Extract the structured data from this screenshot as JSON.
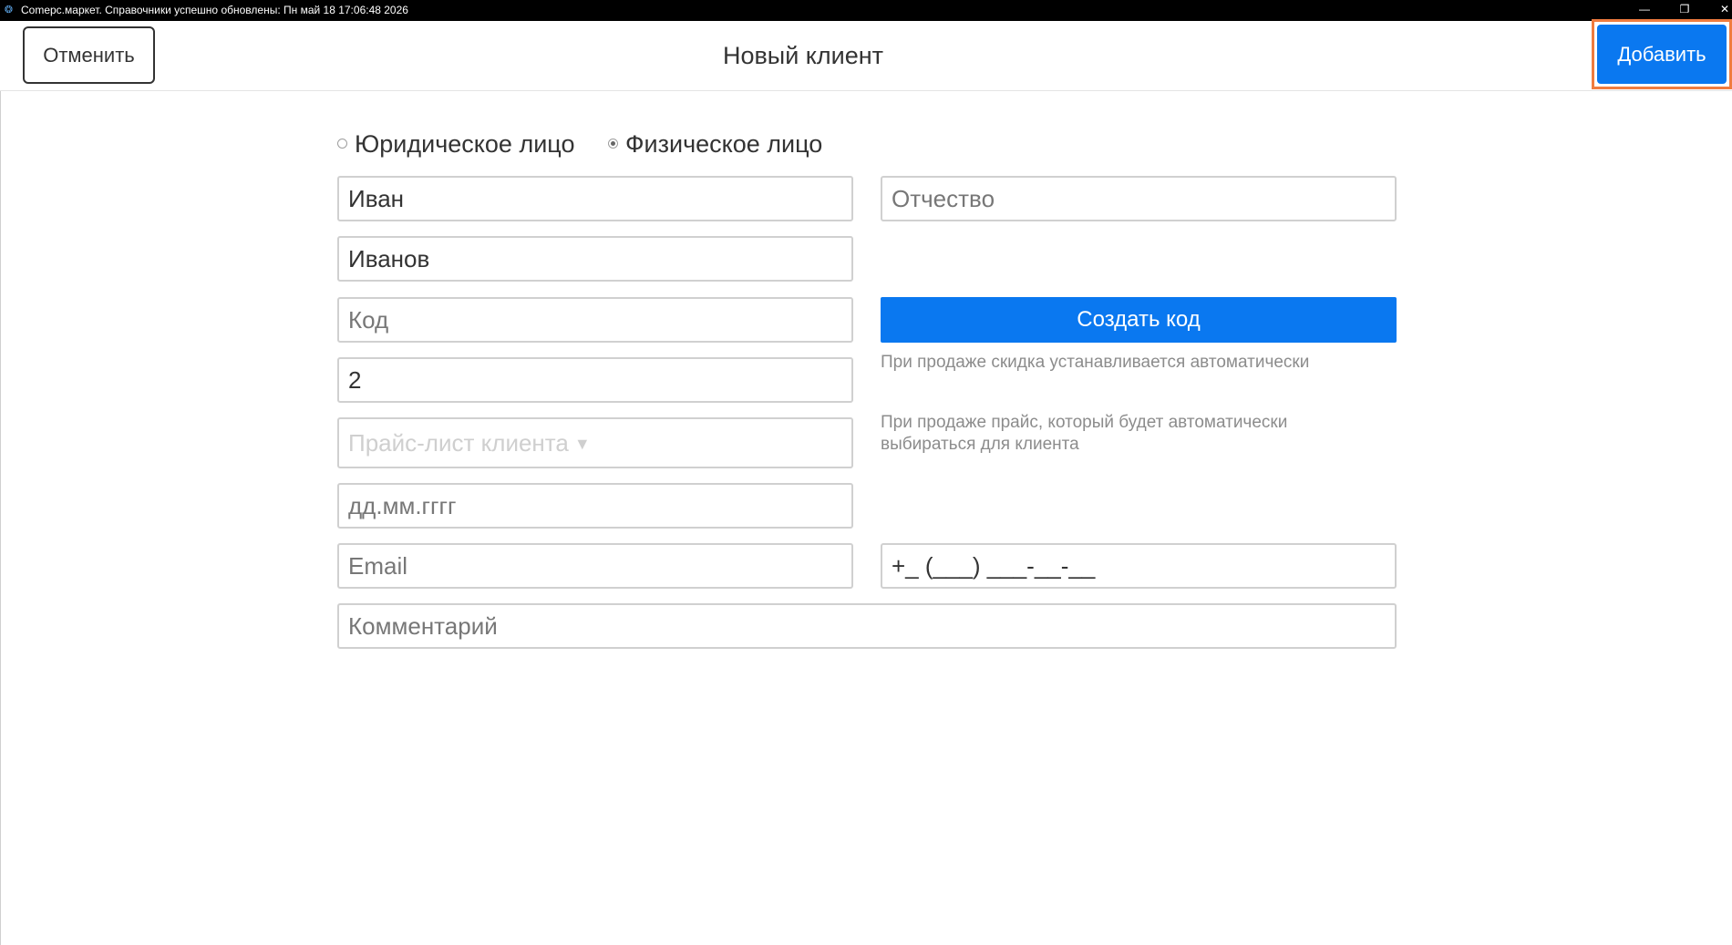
{
  "window": {
    "title": "Comepc.маркет. Справочники успешно обновлены: Пн май 18 17:06:48 2026",
    "minimize_glyph": "—",
    "restore_glyph": "❐",
    "close_glyph": "✕",
    "app_icon_glyph": "❂"
  },
  "header": {
    "cancel_label": "Отменить",
    "title": "Новый клиент",
    "add_label": "Добавить"
  },
  "client_type": {
    "options": [
      {
        "label": "Юридическое лицо",
        "selected": false
      },
      {
        "label": "Физическое лицо",
        "selected": true
      }
    ]
  },
  "form": {
    "first_name": {
      "value": "Иван"
    },
    "patronymic": {
      "placeholder": "Отчество"
    },
    "last_name": {
      "value": "Иванов"
    },
    "code": {
      "placeholder": "Код"
    },
    "create_code_label": "Создать код",
    "discount": {
      "value": "2"
    },
    "discount_hint": "При продаже скидка устанавливается автоматически",
    "price_list": {
      "placeholder": "Прайс-лист клиента",
      "caret": "▼"
    },
    "price_list_hint": "При продаже прайс, который будет автоматически выбираться для клиента",
    "birth_date": {
      "placeholder": "дд.мм.гггг"
    },
    "email": {
      "placeholder": "Email"
    },
    "phone": {
      "mask": "+_ (___) ___-__-__"
    },
    "comment": {
      "placeholder": "Комментарий"
    }
  },
  "colors": {
    "primary": "#0a78f0",
    "highlight_border": "#f07c3f",
    "titlebar_bg": "#000000"
  }
}
